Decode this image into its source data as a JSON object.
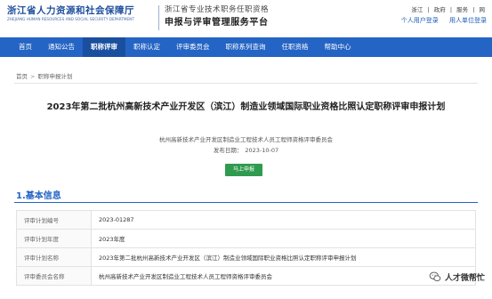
{
  "header": {
    "org_name_cn": "浙江省人力资源和社会保障厅",
    "org_name_en": "ZHEJIANG HUMAN RESOURCES AND SOCIAL SECURITY DEPARTMENT",
    "system_subtitle": "浙江省专业技术职务任职资格",
    "system_title": "申报与评审管理服务平台",
    "top_links": [
      "浙江",
      "|",
      "政府",
      "|",
      "服务",
      "|",
      "网"
    ],
    "personal_login": "个人用户登录",
    "org_login": "用人单位登录"
  },
  "nav": {
    "items": [
      {
        "label": "首页",
        "active": false
      },
      {
        "label": "通知公告",
        "active": false
      },
      {
        "label": "职称评审",
        "active": true
      },
      {
        "label": "职称认定",
        "active": false
      },
      {
        "label": "评审委员会",
        "active": false
      },
      {
        "label": "职称系列查询",
        "active": false
      },
      {
        "label": "任职资格",
        "active": false
      },
      {
        "label": "帮助中心",
        "active": false
      }
    ]
  },
  "breadcrumb": {
    "home": "首页",
    "separator": ">",
    "current": "职称申报计划"
  },
  "plan": {
    "title": "2023年第二批杭州高新技术产业开发区（滨江）制造业领域国际职业资格比照认定职称评审申报计划",
    "issuer": "杭州高新技术产业开发区制造业工程技术人员工程师资格评审委员会",
    "publish_label": "发布日期：",
    "publish_date": "2023-10-07",
    "apply_button": "马上申报"
  },
  "basic_info": {
    "section_title": "1.基本信息",
    "rows": [
      {
        "label": "评审计划编号",
        "value": "2023-01287"
      },
      {
        "label": "评审计划年度",
        "value": "2023年度"
      },
      {
        "label": "评审计划名称",
        "value": "2023年第二批杭州高新技术产业开发区（滨江）制造业领域国际职业资格比照认定职称评审申报计划"
      },
      {
        "label": "评审委员会名称",
        "value": "杭州高新技术产业开发区制造业工程技术人员工程师资格评审委员会"
      }
    ]
  },
  "watermark": {
    "text": "人才微帮忙",
    "icon": "wechat-icon"
  },
  "colors": {
    "nav_bg": "#2464c4",
    "nav_active": "#1a4f9f",
    "accent": "#2464c4",
    "button_green": "#2f9b4f",
    "org_blue": "#1e4f9c"
  }
}
